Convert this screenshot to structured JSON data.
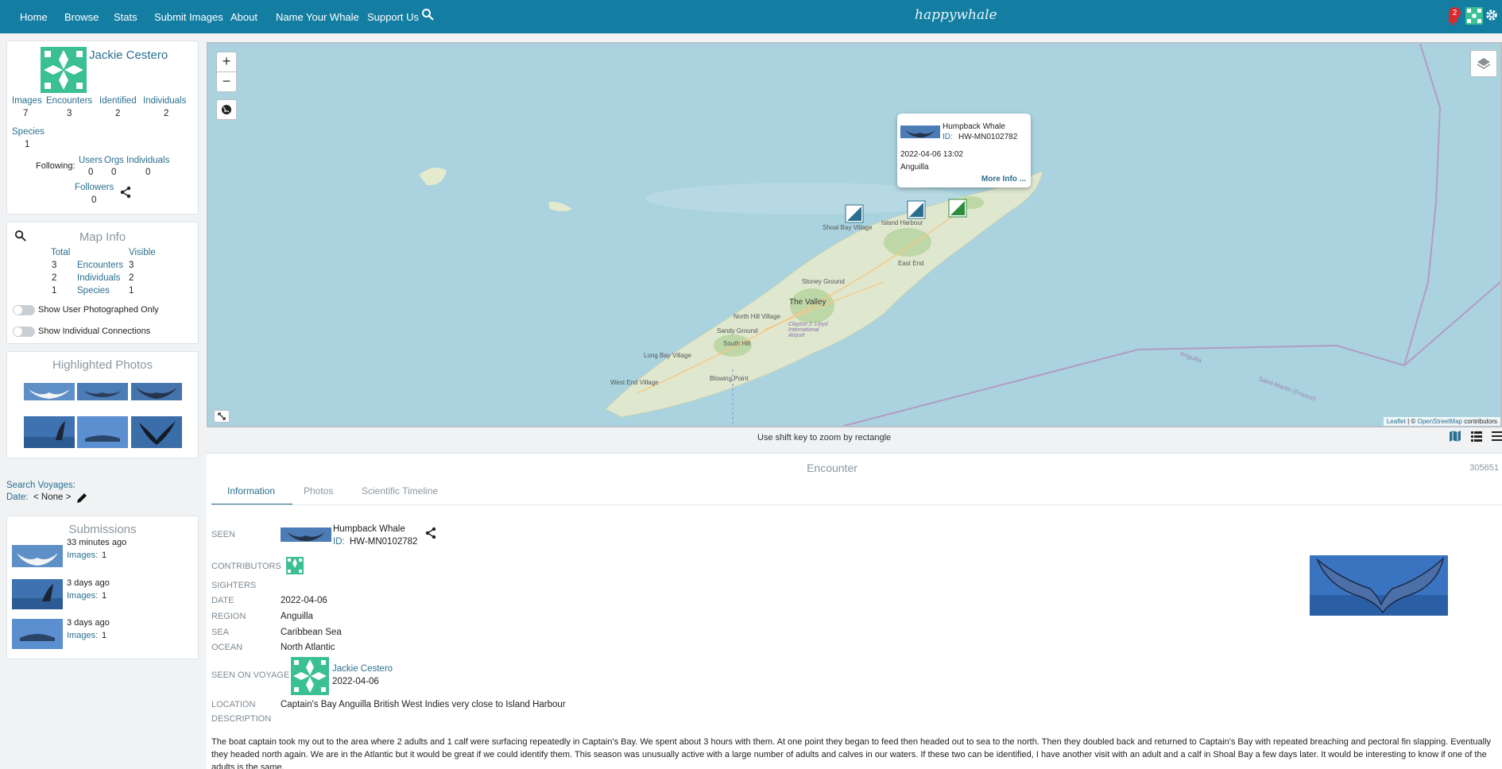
{
  "nav": {
    "items": [
      "Home",
      "Browse",
      "Stats",
      "Submit Images",
      "About",
      "Name Your Whale",
      "Support Us"
    ],
    "brand": "happywhale",
    "notification_count": "2"
  },
  "profile": {
    "name": "Jackie Cestero",
    "stats": [
      {
        "label": "Images",
        "value": "7"
      },
      {
        "label": "Encounters",
        "value": "3"
      },
      {
        "label": "Identified",
        "value": "2"
      },
      {
        "label": "Individuals",
        "value": "2"
      }
    ],
    "species_label": "Species",
    "species_value": "1",
    "following_label": "Following:",
    "following": [
      {
        "label": "Users",
        "value": "0"
      },
      {
        "label": "Orgs",
        "value": "0"
      },
      {
        "label": "Individuals",
        "value": "0"
      }
    ],
    "followers_label": "Followers",
    "followers_value": "0"
  },
  "map_info": {
    "title": "Map Info",
    "total_header": "Total",
    "visible_header": "Visible",
    "rows": [
      {
        "total": "3",
        "label": "Encounters",
        "visible": "3"
      },
      {
        "total": "2",
        "label": "Individuals",
        "visible": "2"
      },
      {
        "total": "1",
        "label": "Species",
        "visible": "1"
      }
    ],
    "toggle_user_photographed": "Show User Photographed Only",
    "toggle_connections": "Show Individual Connections"
  },
  "highlighted": {
    "title": "Highlighted Photos"
  },
  "voyages": {
    "search_label": "Search Voyages:",
    "date_label": "Date:",
    "date_value": "< None >"
  },
  "submissions": {
    "title": "Submissions",
    "items": [
      {
        "time": "33 minutes ago",
        "images_label": "Images:",
        "images": "1"
      },
      {
        "time": "3 days ago",
        "images_label": "Images:",
        "images": "1"
      },
      {
        "time": "3 days ago",
        "images_label": "Images:",
        "images": "1"
      }
    ]
  },
  "map": {
    "popup": {
      "species": "Humpback Whale",
      "id_label": "ID:",
      "id": "HW-MN0102782",
      "datetime": "2022-04-06 13:02",
      "region": "Anguilla",
      "more": "More Info ..."
    },
    "towns": [
      "Shoal Bay Village",
      "Island Harbour",
      "East End",
      "Stoney Ground",
      "The Valley",
      "North Hill Village",
      "Sandy Ground",
      "South Hill",
      "Clayton J. Lloyd International Airport",
      "Long Bay Village",
      "West End Village",
      "Blowing Point",
      "Anguilla",
      "Saint-Martin (France)"
    ],
    "attribution_leaflet": "Leaflet",
    "attribution_osm": "OpenStreetMap",
    "attribution_rest": "contributors",
    "hint": "Use shift key to zoom by rectangle"
  },
  "encounter": {
    "title": "Encounter",
    "number": "305651",
    "tabs": [
      "Information",
      "Photos",
      "Scientific Timeline"
    ],
    "seen_label": "SEEN",
    "species": "Humpback Whale",
    "id_label": "ID:",
    "id": "HW-MN0102782",
    "contributors_label": "CONTRIBUTORS",
    "sighters_label": "SIGHTERS",
    "date_label": "DATE",
    "date": "2022-04-06",
    "region_label": "REGION",
    "region": "Anguilla",
    "sea_label": "SEA",
    "sea": "Caribbean Sea",
    "ocean_label": "OCEAN",
    "ocean": "North Atlantic",
    "voyage_label": "SEEN ON VOYAGE",
    "voyage_user": "Jackie Cestero",
    "voyage_date": "2022-04-06",
    "location_label": "LOCATION",
    "location": "Captain's Bay Anguilla British West Indies very close to Island Harbour",
    "description_label": "DESCRIPTION",
    "description": "The boat captain took my out to the area where 2 adults and 1 calf were surfacing repeatedly in Captain's Bay. We spent about 3 hours with them. At one point they began to feed then headed out to sea to the north. Then they doubled back and returned to Captain's Bay with repeated breaching and pectoral fin slapping. Eventually they headed north again. We are in the Atlantic but it would be great if we could identify them. This season was unusually active with a large number of adults and calves in our waters. If these two can be identified, I have another visit with an adult and a calf in Shoal Bay a few days later. It would be interesting to know if one of the adults is the same."
  },
  "colors": {
    "accent": "#147ea2",
    "link": "#2a6f8f",
    "water": "#aad3df",
    "land": "#dfe8cf"
  },
  "icons": [
    "search-icon",
    "bell-icon",
    "grid-icon",
    "gear-icon",
    "share-icon",
    "pencil-icon",
    "globe-icon",
    "layers-icon",
    "fullscreen-icon",
    "map-view-icon",
    "list-view-icon",
    "menu-icon"
  ]
}
